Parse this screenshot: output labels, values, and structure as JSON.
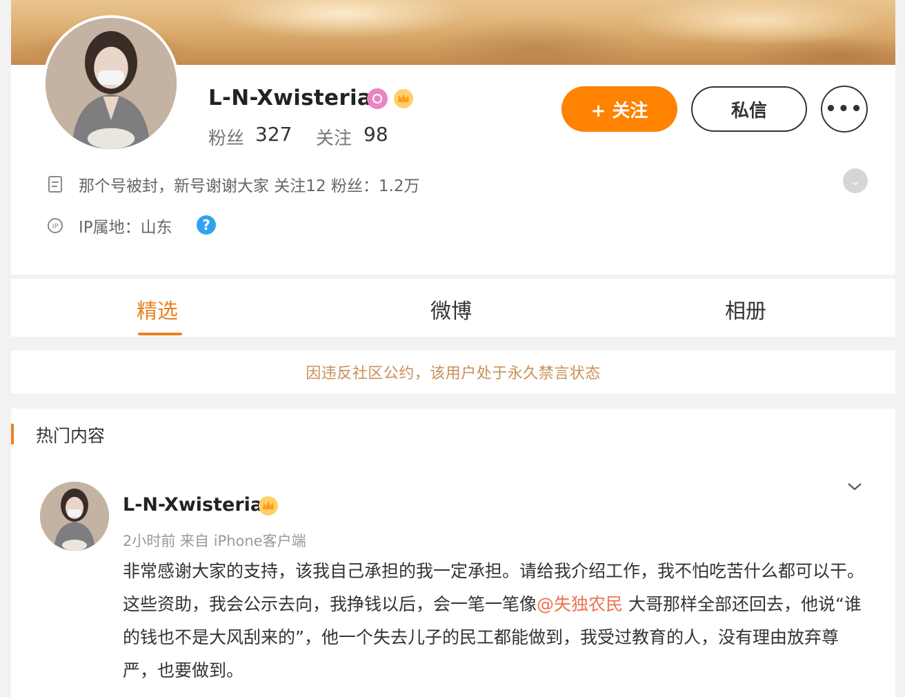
{
  "profile": {
    "username": "L-N-Xwisteria",
    "followers_label": "粉丝",
    "followers_count": "327",
    "following_label": "关注",
    "following_count": "98",
    "follow_button": "+ 关注",
    "message_button": "私信",
    "more_button": "•••",
    "bio": "那个号被封，新号谢谢大家 关注12 粉丝：1.2万",
    "ip_location": "IP属地：山东",
    "help_symbol": "?"
  },
  "tabs": [
    {
      "label": "精选",
      "active": true
    },
    {
      "label": "微博",
      "active": false
    },
    {
      "label": "相册",
      "active": false
    }
  ],
  "notice": "因违反社区公约，该用户处于永久禁言状态",
  "feed": {
    "section_title": "热门内容",
    "post": {
      "author": "L-N-Xwisteria",
      "meta": "2小时前 来自 iPhone客户端",
      "body_before": "非常感谢大家的支持，该我自己承担的我一定承担。请给我介绍工作，我不怕吃苦什么都可以干。 这些资助，我会公示去向，我挣钱以后，会一笔一笔像",
      "mention": "@失独农民",
      "body_after": " 大哥那样全部还回去，他说“谁的钱也不是大风刮来的”，他一个失去儿子的民工都能做到，我受过教育的人，没有理由放弃尊严，也要做到。"
    }
  },
  "colors": {
    "accent": "#ff8200",
    "tab_active": "#e8821e",
    "mention": "#eb7350",
    "notice": "#c98f57"
  }
}
